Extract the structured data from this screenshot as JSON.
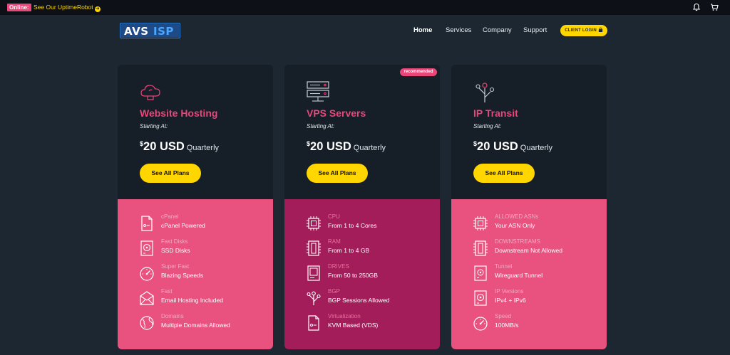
{
  "topbar": {
    "status_badge": "Online:",
    "uptime_link": "See Our UptimeRobot",
    "icons": [
      "bell-icon",
      "cart-icon"
    ]
  },
  "header": {
    "logo": {
      "part1": "AVS",
      "part2": "ISP"
    },
    "nav": [
      "Home",
      "Services",
      "Company",
      "Support"
    ],
    "login_button": "CLIENT LOGIN"
  },
  "cards": [
    {
      "icon": "cloud-icon",
      "title": "Website Hosting",
      "starting": "Starting At:",
      "price": {
        "currency": "$",
        "amount": "20 USD",
        "period": "Quarterly"
      },
      "button": "See All Plans",
      "features": [
        {
          "icon": "document-icon",
          "key": "cPanel",
          "value": "cPanel Powered"
        },
        {
          "icon": "disk-icon",
          "key": "Fast Disks",
          "value": "SSD Disks"
        },
        {
          "icon": "speedometer-icon",
          "key": "Super Fast",
          "value": "Blazing Speeds"
        },
        {
          "icon": "envelope-icon",
          "key": "Fast",
          "value": "Email Hosting Included"
        },
        {
          "icon": "globe-icon",
          "key": "Domains",
          "value": "Multiple Domains Allowed"
        }
      ]
    },
    {
      "icon": "server-icon",
      "badge": "recommended",
      "title": "VPS Servers",
      "starting": "Starting At:",
      "price": {
        "currency": "$",
        "amount": "20 USD",
        "period": "Quarterly"
      },
      "button": "See All Plans",
      "features": [
        {
          "icon": "cpu-icon",
          "key": "CPU",
          "value": "From 1 to 4 Cores"
        },
        {
          "icon": "memory-icon",
          "key": "RAM",
          "value": "From 1 to 4 GB"
        },
        {
          "icon": "drive-icon",
          "key": "DRIVES",
          "value": "From 50 to 250GB"
        },
        {
          "icon": "network-icon",
          "key": "BGP",
          "value": "BGP Sessions Allowed"
        },
        {
          "icon": "document-icon",
          "key": "Virtualization",
          "value": "KVM Based (VDS)"
        }
      ]
    },
    {
      "icon": "network-icon",
      "title": "IP Transit",
      "starting": "Starting At:",
      "price": {
        "currency": "$",
        "amount": "20 USD",
        "period": "Quarterly"
      },
      "button": "See All Plans",
      "features": [
        {
          "icon": "cpu-icon",
          "key": "ALLOWED ASNs",
          "value": "Your ASN Only"
        },
        {
          "icon": "memory-icon",
          "key": "DOWNSTREAMS",
          "value": "Downstream Not Allowed"
        },
        {
          "icon": "drive-icon",
          "key": "Tunnel",
          "value": "Wireguard Tunnel"
        },
        {
          "icon": "disk-icon",
          "key": "IP Versions",
          "value": "IPv4 + IPv6"
        },
        {
          "icon": "speedometer-icon",
          "key": "Speed",
          "value": "100MB/s"
        }
      ]
    }
  ],
  "colors": {
    "background": "#1c2732",
    "topbar": "#0d1117",
    "card_top": "#161e27",
    "accent_pink": "#e9467a",
    "card_bottom": "#e9517f",
    "card_bottom_featured": "#a31d5a",
    "yellow": "#ffd600"
  }
}
